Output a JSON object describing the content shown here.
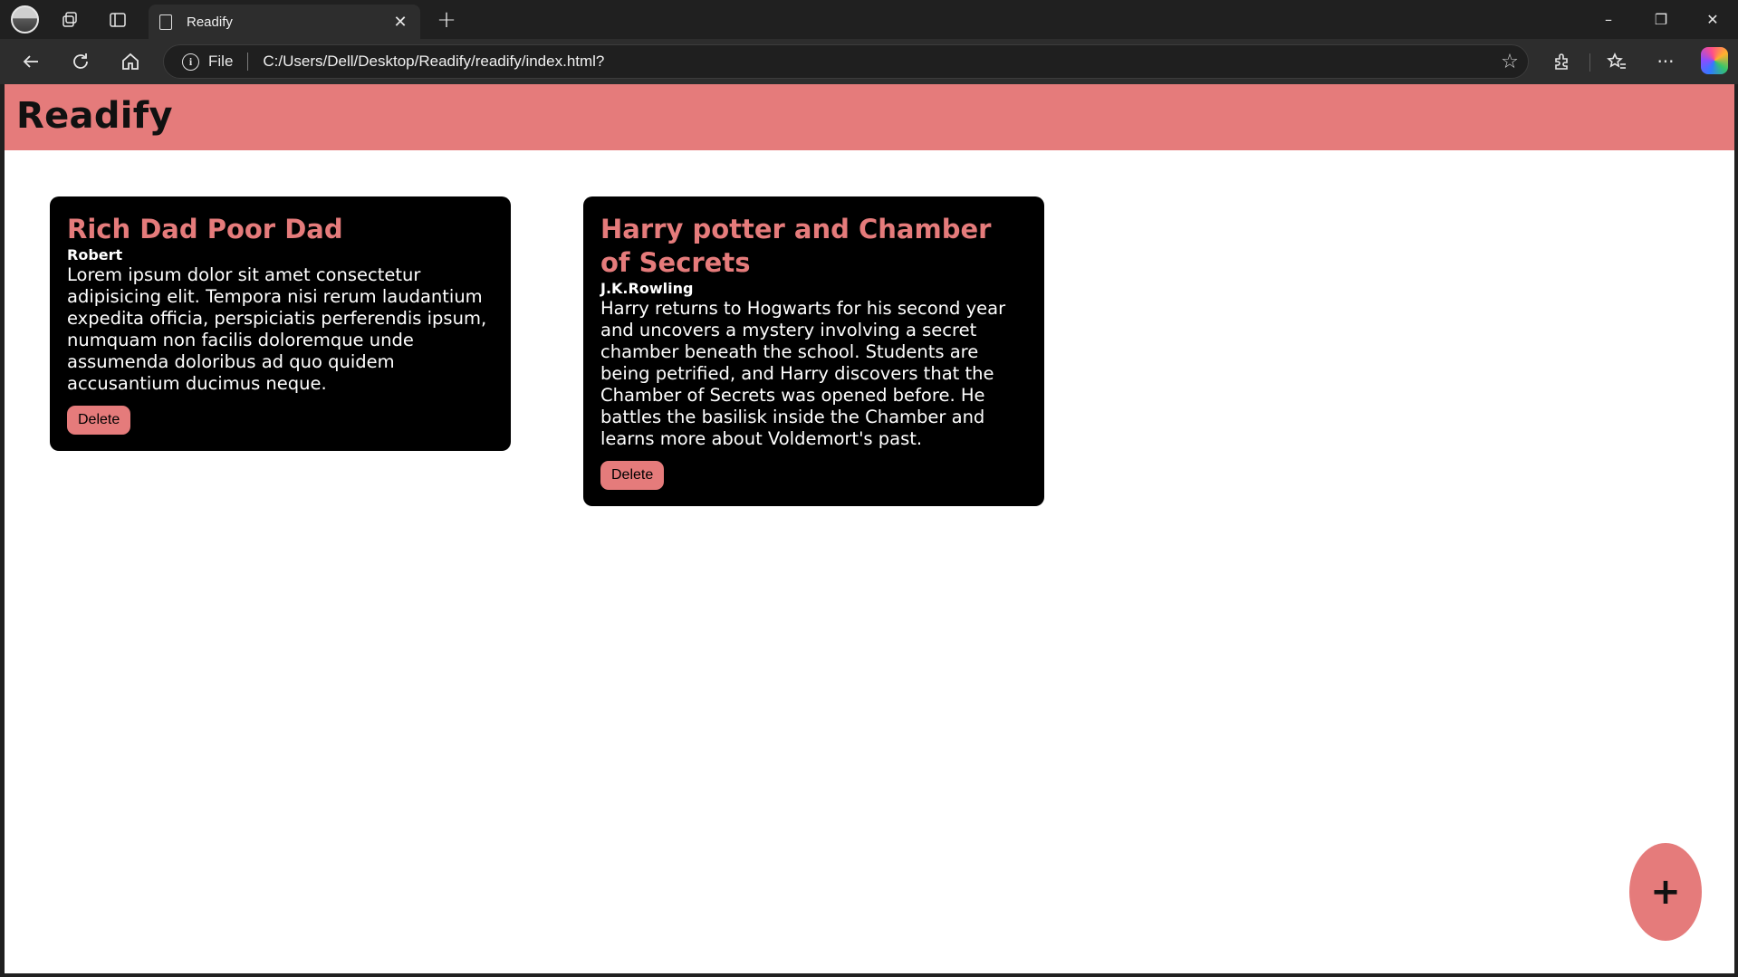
{
  "browser": {
    "tab_title": "Readify",
    "tab_close_icon": "close-icon",
    "new_tab_icon": "plus-icon",
    "address": {
      "scheme_label": "File",
      "url": "C:/Users/Dell/Desktop/Readify/readify/index.html?"
    },
    "window_controls": {
      "minimize": "–",
      "restore": "❐",
      "close": "✕"
    }
  },
  "app": {
    "title": "Readify",
    "accent_color": "#e57b7b",
    "books": [
      {
        "title": "Rich Dad Poor Dad",
        "author": "Robert",
        "description": "Lorem ipsum dolor sit amet consectetur adipisicing elit. Tempora nisi rerum laudantium expedita officia, perspiciatis perferendis ipsum, numquam non facilis doloremque unde assumenda doloribus ad quo quidem accusantium ducimus neque.",
        "delete_label": "Delete"
      },
      {
        "title": "Harry potter and Chamber of Secrets",
        "author": "J.K.Rowling",
        "description": "Harry returns to Hogwarts for his second year and uncovers a mystery involving a secret chamber beneath the school. Students are being petrified, and Harry discovers that the Chamber of Secrets was opened before. He battles the basilisk inside the Chamber and learns more about Voldemort's past.",
        "delete_label": "Delete"
      }
    ],
    "add_button_label": "+"
  }
}
